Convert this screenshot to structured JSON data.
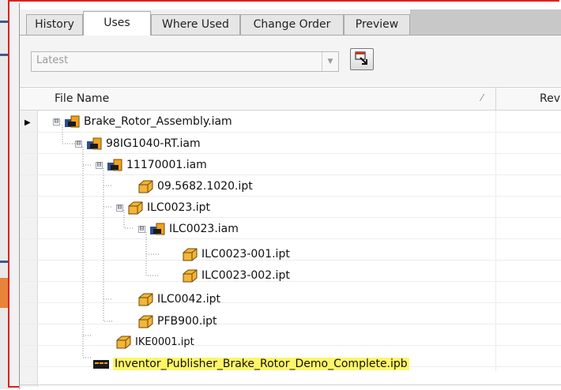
{
  "tabs": [
    "History",
    "Uses",
    "Where Used",
    "Change Order",
    "Preview"
  ],
  "active_tab": "Uses",
  "toolbar": {
    "version_value": "Latest",
    "action_icon": "goto-file-icon"
  },
  "grid": {
    "columns": {
      "file_name": "File Name",
      "rev": "Rev"
    },
    "rows": [
      {
        "name": "Brake_Rotor_Assembly.iam",
        "type": "assembly",
        "expander": "⊟"
      },
      {
        "name": "98IG1040-RT.iam",
        "type": "assembly",
        "expander": "⊟"
      },
      {
        "name": "11170001.iam",
        "type": "assembly",
        "expander": "⊟"
      },
      {
        "name": "09.5682.1020.ipt",
        "type": "part",
        "expander": ""
      },
      {
        "name": "ILC0023.ipt",
        "type": "part",
        "expander": "⊟"
      },
      {
        "name": "ILC0023.iam",
        "type": "assembly",
        "expander": "⊟"
      },
      {
        "name": "ILC0023-001.ipt",
        "type": "part",
        "expander": ""
      },
      {
        "name": "ILC0023-002.ipt",
        "type": "part",
        "expander": ""
      },
      {
        "name": "ILC0042.ipt",
        "type": "part",
        "expander": ""
      },
      {
        "name": "PFB900.ipt",
        "type": "part",
        "expander": ""
      },
      {
        "name": "IKE0001.ipt",
        "type": "part",
        "expander": ""
      },
      {
        "name": "Inventor_Publisher_Brake_Rotor_Demo_Complete.ipb",
        "type": "publisher",
        "expander": "",
        "highlight_color": "#fff568"
      }
    ]
  },
  "colors": {
    "frame_accent": "#e02020",
    "highlight": "#fff568"
  }
}
